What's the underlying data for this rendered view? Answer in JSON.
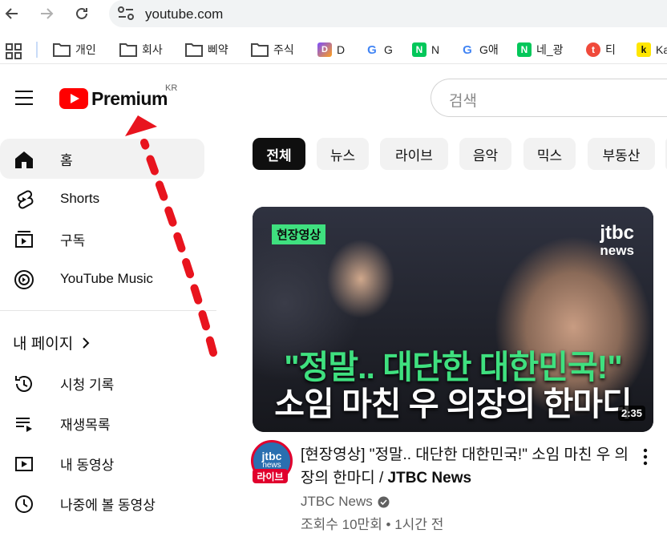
{
  "browser": {
    "url": "youtube.com"
  },
  "bookmarks": [
    {
      "label": "개인",
      "icon": "folder-icon"
    },
    {
      "label": "회사",
      "icon": "folder-icon"
    },
    {
      "label": "삐약",
      "icon": "folder-icon"
    },
    {
      "label": "주식",
      "icon": "folder-icon"
    },
    {
      "label": "D",
      "icon": "d-favicon"
    },
    {
      "label": "G",
      "icon": "google-favicon"
    },
    {
      "label": "N",
      "icon": "naver-favicon"
    },
    {
      "label": "G애",
      "icon": "google-favicon"
    },
    {
      "label": "네_광",
      "icon": "naver-favicon"
    },
    {
      "label": "티",
      "icon": "t-favicon"
    },
    {
      "label": "Ka",
      "icon": "k-favicon"
    }
  ],
  "header": {
    "logo_text": "Premium",
    "region": "KR",
    "search_placeholder": "검색"
  },
  "sidebar": {
    "items": [
      {
        "label": "홈",
        "icon": "home-icon"
      },
      {
        "label": "Shorts",
        "icon": "shorts-icon"
      },
      {
        "label": "구독",
        "icon": "subscriptions-icon"
      },
      {
        "label": "YouTube Music",
        "icon": "youtube-music-icon"
      }
    ],
    "my_page_label": "내 페이지",
    "my_items": [
      {
        "label": "시청 기록",
        "icon": "history-icon"
      },
      {
        "label": "재생목록",
        "icon": "playlist-icon"
      },
      {
        "label": "내 동영상",
        "icon": "my-videos-icon"
      },
      {
        "label": "나중에 볼 동영상",
        "icon": "watch-later-icon"
      }
    ]
  },
  "chips": [
    "전체",
    "뉴스",
    "라이브",
    "음악",
    "믹스",
    "부동산"
  ],
  "video": {
    "thumb_tag": "현장영상",
    "thumb_brand_top": "jtbc",
    "thumb_brand_bottom": "news",
    "thumb_line1": "\"정말.. 대단한 대한민국!\"",
    "thumb_line2": "소임 마친 우 의장의 한마디",
    "duration": "2:35",
    "avatar_line1": "jtbc",
    "avatar_line2": "news",
    "live_badge": "라이브",
    "title": "[현장영상] \"정말.. 대단한 대한민국!\" 소임 마친 우 의장의 한마디 / ",
    "title_channel": "JTBC News",
    "channel": "JTBC News",
    "meta": "조회수 10만회 • 1시간 전"
  },
  "colors": {
    "brand_red": "#ff0000",
    "arrow_red": "#e8141e",
    "thumb_green": "#3fe07f"
  }
}
